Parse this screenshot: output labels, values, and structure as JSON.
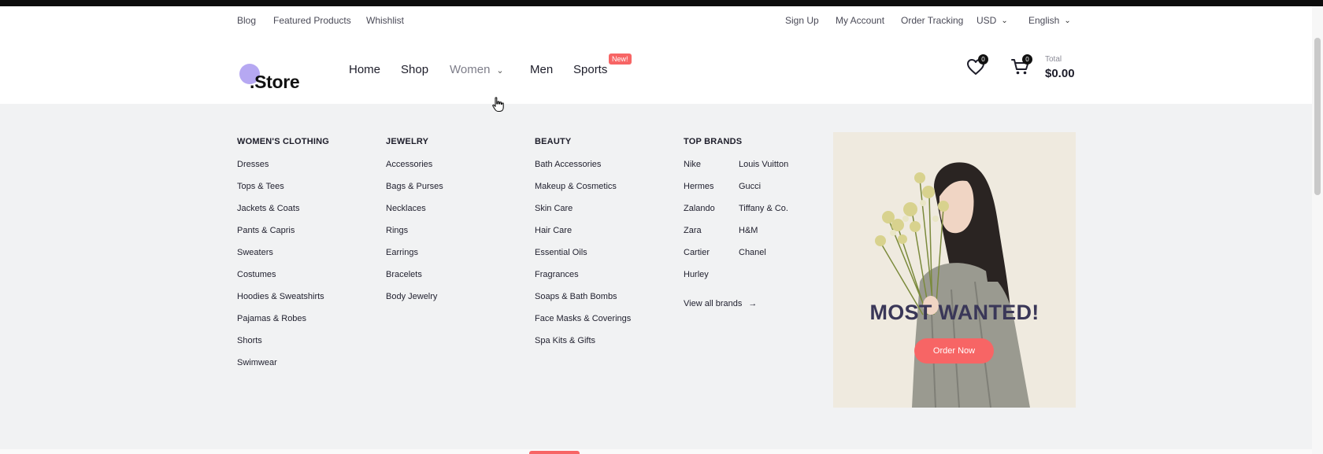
{
  "utility": {
    "left_links": [
      "Blog",
      "Featured Products",
      "Whishlist"
    ],
    "right_links": [
      "Sign Up",
      "My Account",
      "Order Tracking"
    ],
    "currency": "USD",
    "language": "English"
  },
  "header": {
    "logo_text": ".Store",
    "nav": {
      "home": "Home",
      "shop": "Shop",
      "women": "Women",
      "men": "Men",
      "sports": "Sports",
      "sports_badge": "New!"
    },
    "wishlist_count": "0",
    "cart_count": "0",
    "total_label": "Total",
    "total_value": "$0.00"
  },
  "megamenu": {
    "clothing": {
      "title": "WOMEN'S CLOTHING",
      "items": [
        "Dresses",
        "Tops & Tees",
        "Jackets & Coats",
        "Pants & Capris",
        "Sweaters",
        "Costumes",
        "Hoodies & Sweatshirts",
        "Pajamas & Robes",
        "Shorts",
        "Swimwear"
      ]
    },
    "jewelry": {
      "title": "JEWELRY",
      "items": [
        "Accessories",
        "Bags & Purses",
        "Necklaces",
        "Rings",
        "Earrings",
        "Bracelets",
        "Body Jewelry"
      ]
    },
    "beauty": {
      "title": "BEAUTY",
      "items": [
        "Bath Accessories",
        "Makeup & Cosmetics",
        "Skin Care",
        "Hair Care",
        "Essential Oils",
        "Fragrances",
        "Soaps & Bath Bombs",
        "Face Masks & Coverings",
        "Spa Kits & Gifts"
      ]
    },
    "brands": {
      "title": "TOP BRANDS",
      "col1": [
        "Nike",
        "Hermes",
        "Zalando",
        "Zara",
        "Cartier",
        "Hurley"
      ],
      "col2": [
        "Louis Vuitton",
        "Gucci",
        "Tiffany & Co.",
        "H&M",
        "Chanel"
      ],
      "view_all": "View all brands"
    },
    "promo": {
      "title": "MOST WANTED!",
      "button": "Order Now"
    }
  },
  "colors": {
    "accent": "#f76565",
    "logo_dot": "#b6a8f2",
    "menu_bg": "#f1f2f3",
    "promo_title": "#3a3758"
  },
  "icons": [
    "heart-icon",
    "cart-icon",
    "chevron-down-icon",
    "arrow-right-icon",
    "pointer-cursor-icon"
  ]
}
